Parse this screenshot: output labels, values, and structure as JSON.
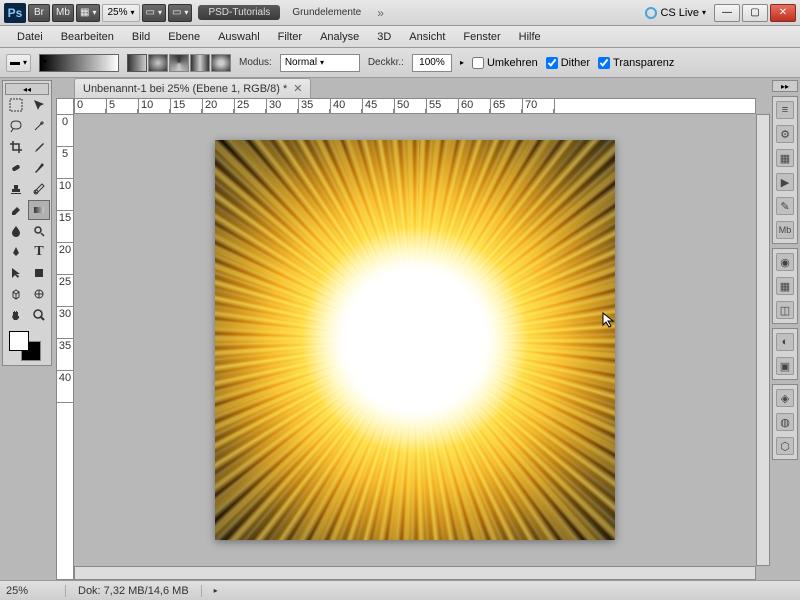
{
  "titlebar": {
    "logo": "Ps",
    "br": "Br",
    "mb": "Mb",
    "zoom": "25%",
    "workspace_primary": "PSD-Tutorials",
    "workspace_secondary": "Grundelemente",
    "cslive": "CS Live"
  },
  "menu": [
    "Datei",
    "Bearbeiten",
    "Bild",
    "Ebene",
    "Auswahl",
    "Filter",
    "Analyse",
    "3D",
    "Ansicht",
    "Fenster",
    "Hilfe"
  ],
  "options": {
    "mode_label": "Modus:",
    "mode_value": "Normal",
    "opacity_label": "Deckkr.:",
    "opacity_value": "100%",
    "reverse": "Umkehren",
    "dither": "Dither",
    "transparency": "Transparenz"
  },
  "document": {
    "tab_title": "Unbenannt-1 bei 25% (Ebene 1, RGB/8) *"
  },
  "ruler_h": [
    "0",
    "5",
    "10",
    "15",
    "20",
    "25",
    "30",
    "35",
    "40",
    "45",
    "50",
    "55",
    "60",
    "65",
    "70"
  ],
  "ruler_v": [
    "0",
    "5",
    "10",
    "15",
    "20",
    "25",
    "30",
    "35",
    "40"
  ],
  "status": {
    "zoom": "25%",
    "doc": "Dok: 7,32 MB/14,6 MB"
  },
  "tools": [
    "move",
    "marquee",
    "lasso",
    "wand",
    "crop",
    "eyedropper",
    "heal",
    "brush",
    "stamp",
    "history",
    "eraser",
    "gradient",
    "blur",
    "dodge",
    "pen",
    "type",
    "path",
    "shape",
    "3d",
    "3drot",
    "hand",
    "zoom"
  ]
}
